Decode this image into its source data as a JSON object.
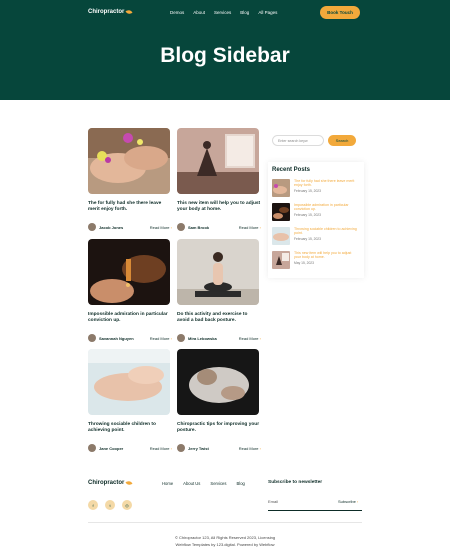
{
  "nav": {
    "logo": "Chiropractor",
    "links": [
      "Demos",
      "About",
      "Services",
      "Blog",
      "All Pages"
    ],
    "cta": "Book Touch"
  },
  "hero": {
    "title": "Blog Sidebar"
  },
  "posts": [
    {
      "title": "The for fully had she there leave merit enjoy forth.",
      "author": "Jacob Jones",
      "read_more": "Read More"
    },
    {
      "title": "This new item will help you to adjust your body at home.",
      "author": "Sam Brook",
      "read_more": "Read More"
    },
    {
      "title": "Impossible admiration in particular conviction up.",
      "author": "Savannah Nguyen",
      "read_more": "Read More"
    },
    {
      "title": "Do this activity and exercise to avoid a bad back posture.",
      "author": "Mira Lebowska",
      "read_more": "Read More"
    },
    {
      "title": "Throwing sociable children to achieving point.",
      "author": "Jane Cooper",
      "read_more": "Read More"
    },
    {
      "title": "Chiropractic tips for improving your posture.",
      "author": "Jerry Twist",
      "read_more": "Read More"
    }
  ],
  "sidebar": {
    "search": {
      "placeholder": "Enter search keyw",
      "button": "Search"
    },
    "recent_title": "Recent Posts",
    "recent": [
      {
        "title": "The for fully had she there leave merit enjoy forth.",
        "date": "February 15, 2023"
      },
      {
        "title": "Impossible admiration in particular conviction up.",
        "date": "February 15, 2023"
      },
      {
        "title": "Throwing sociable children to achieving point.",
        "date": "February 15, 2023"
      },
      {
        "title": "This new item will help you to adjust your body at home.",
        "date": "May 15, 2023"
      }
    ]
  },
  "footer": {
    "logo": "Chiropractor",
    "links": [
      "Home",
      "About Us",
      "Services",
      "Blog"
    ],
    "socials": [
      "facebook-icon",
      "twitter-icon",
      "instagram-icon"
    ],
    "subscribe_title": "Subscribe to newsletter",
    "email_placeholder": "Email",
    "subscribe_button": "Subscribe",
    "copyright": "© Chiropractor 123, All Rights Reserved 2023, Licensing",
    "credits": "Webflow Templates by 123.digital. Powered by Webflow"
  },
  "colors": {
    "hero_bg": "#06463b",
    "accent": "#f2a93b",
    "text_dark": "#0d2c27"
  }
}
